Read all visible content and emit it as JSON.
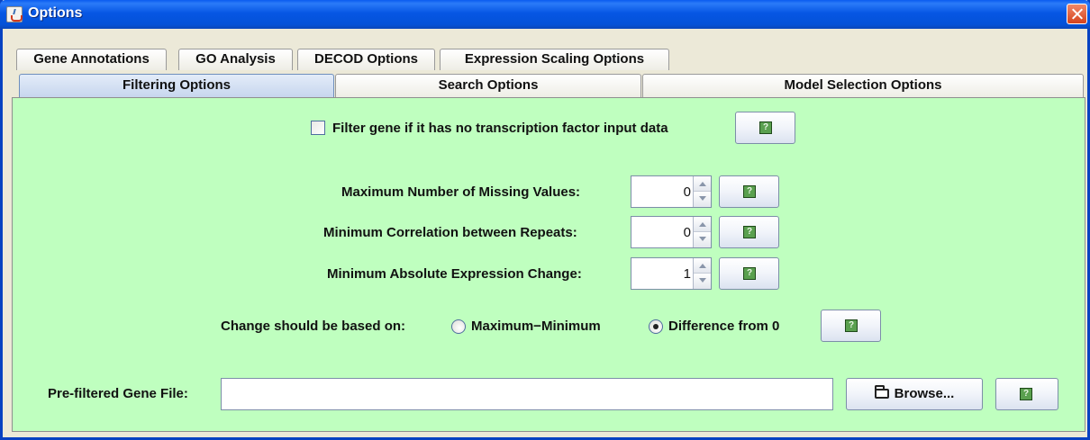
{
  "window": {
    "title": "Options"
  },
  "tabs": {
    "row1": [
      "Gene Annotations",
      "GO Analysis",
      "DECOD Options",
      "Expression Scaling Options"
    ],
    "row2": [
      "Filtering Options",
      "Search Options",
      "Model Selection Options"
    ],
    "selected": "Filtering Options"
  },
  "filtering": {
    "filter_tf_checkbox": {
      "label": "Filter gene if it has no transcription factor input data",
      "checked": false
    },
    "help_glyph": "?",
    "max_missing": {
      "label": "Maximum Number of Missing Values:",
      "value": "0"
    },
    "min_correlation": {
      "label": "Minimum Correlation between Repeats:",
      "value": "0"
    },
    "min_abs_change": {
      "label": "Minimum Absolute Expression Change:",
      "value": "1"
    },
    "change_basis": {
      "label": "Change should be based on:",
      "options": [
        "Maximum−Minimum",
        "Difference from 0"
      ],
      "selected": "Difference from 0"
    },
    "prefiltered_file": {
      "label": "Pre-filtered Gene File:",
      "value": ""
    },
    "browse_label": "Browse..."
  },
  "colors": {
    "content_bg": "#bfffbf",
    "titlebar": "#0656e4",
    "close": "#d5431c"
  },
  "icons": [
    "java-app-icon",
    "close-icon",
    "help-icon",
    "folder-open-icon"
  ]
}
